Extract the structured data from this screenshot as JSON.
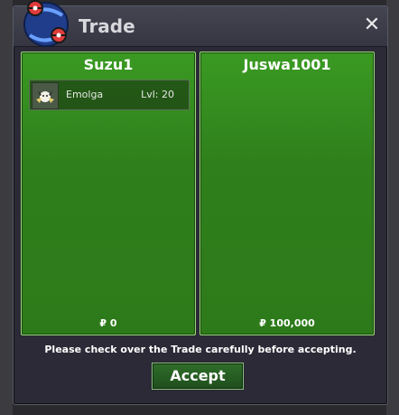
{
  "window": {
    "title": "Trade"
  },
  "panels": [
    {
      "player_name": "Suzu1",
      "money": "₽ 0",
      "pokemon": [
        {
          "name": "Emolga",
          "level": "Lvl: 20"
        }
      ]
    },
    {
      "player_name": "Juswa1001",
      "money": "₽ 100,000",
      "pokemon": []
    }
  ],
  "footer": {
    "message": "Please check over the Trade carefully before accepting.",
    "accept_label": "Accept"
  },
  "colors": {
    "panel_green": "#2f7f1c",
    "window_bg": "#2b2a36",
    "accept_green": "#2f6e2a"
  }
}
